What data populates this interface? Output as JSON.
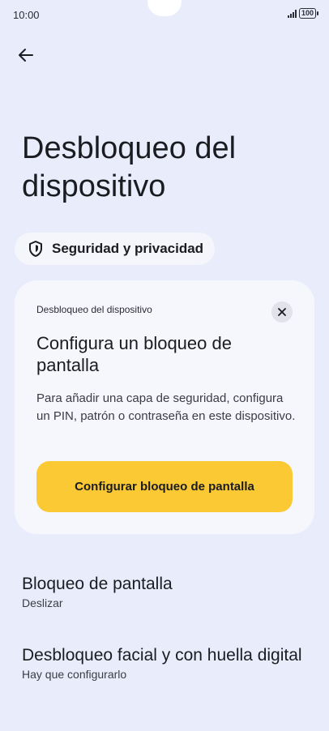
{
  "status_bar": {
    "time": "10:00",
    "battery": "100"
  },
  "header": {
    "back_icon": "arrow-left-icon",
    "title": "Desbloqueo del dispositivo"
  },
  "category_chip": {
    "icon": "shield-icon",
    "label": "Seguridad y privacidad"
  },
  "card": {
    "overline": "Desbloqueo del dispositivo",
    "close_icon": "close-icon",
    "title": "Configura un bloqueo de pantalla",
    "body": "Para añadir una capa de seguridad, configura un PIN, patrón o contraseña en este dispositivo.",
    "button_label": "Configurar bloqueo de pantalla"
  },
  "settings": [
    {
      "title": "Bloqueo de pantalla",
      "subtitle": "Deslizar"
    },
    {
      "title": "Desbloqueo facial y con huella digital",
      "subtitle": "Hay que configurarlo"
    }
  ],
  "colors": {
    "background": "#e9edfb",
    "card": "#f6f7fd",
    "accent_button": "#fbc933"
  }
}
